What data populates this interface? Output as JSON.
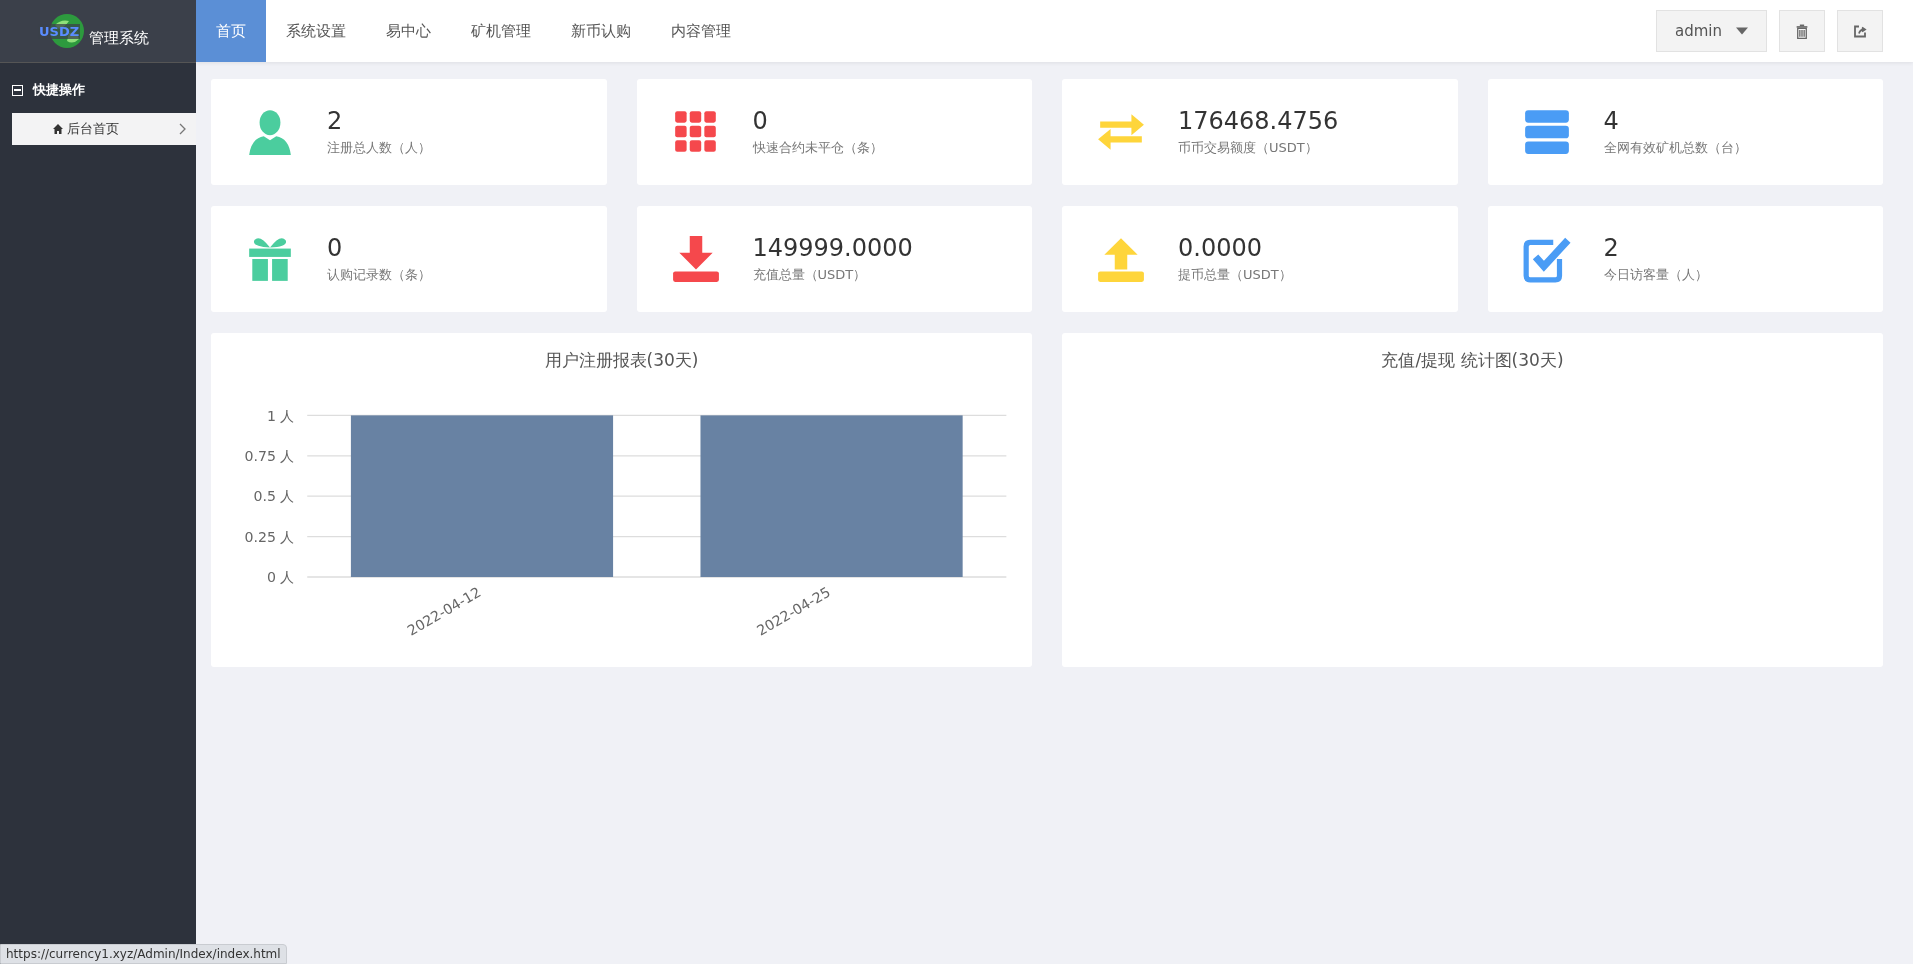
{
  "logo": {
    "badge": "USDZ",
    "title": "管理系统"
  },
  "nav": [
    {
      "label": "首页",
      "selected": true
    },
    {
      "label": "系统设置",
      "selected": false
    },
    {
      "label": "易中心",
      "selected": false
    },
    {
      "label": "矿机管理",
      "selected": false
    },
    {
      "label": "新币认购",
      "selected": false
    },
    {
      "label": "内容管理",
      "selected": false
    }
  ],
  "user_menu": {
    "label": "admin"
  },
  "sidebar": {
    "section": {
      "label": "快捷操作",
      "expanded": true,
      "items": [
        {
          "label": "后台首页",
          "selected": true
        }
      ]
    }
  },
  "stats": [
    {
      "kind": "user",
      "color": "#4bcd9e",
      "value": "2",
      "label": "注册总人数（人）"
    },
    {
      "kind": "grid",
      "color": "#f5484c",
      "value": "0",
      "label": "快速合约未平仓（条）"
    },
    {
      "kind": "exchange",
      "color": "#fed53b",
      "value": "176468.4756",
      "label": "币币交易额度（USDT）"
    },
    {
      "kind": "server",
      "color": "#4a9cf5",
      "value": "4",
      "label": "全网有效矿机总数（台）"
    },
    {
      "kind": "gift",
      "color": "#4bcd9e",
      "value": "0",
      "label": "认购记录数（条）"
    },
    {
      "kind": "download",
      "color": "#f5484c",
      "value": "149999.0000",
      "label": "充值总量（USDT）"
    },
    {
      "kind": "upload",
      "color": "#fed53b",
      "value": "0.0000",
      "label": "提币总量（USDT）"
    },
    {
      "kind": "check",
      "color": "#4a9cf5",
      "value": "2",
      "label": "今日访客量（人）"
    }
  ],
  "charts": [
    {
      "title": "用户注册报表(30天)",
      "chart_data": {
        "type": "bar",
        "categories": [
          "2022-04-12",
          "2022-04-25"
        ],
        "series": [
          {
            "color": "#6882a3",
            "values": [
              1,
              1
            ]
          }
        ],
        "grid": true,
        "ylim": [
          0,
          1
        ],
        "yticks": [
          {
            "value": 0,
            "label": "0 人"
          },
          {
            "value": 0.25,
            "label": "0.25 人"
          },
          {
            "value": 0.5,
            "label": "0.5 人"
          },
          {
            "value": 0.75,
            "label": "0.75 人"
          },
          {
            "value": 1,
            "label": "1 人"
          }
        ]
      }
    },
    {
      "title": "充值/提现 统计图(30天)"
    }
  ],
  "status_bar": {
    "url": "https://currency1.xyz/Admin/Index/index.html"
  }
}
